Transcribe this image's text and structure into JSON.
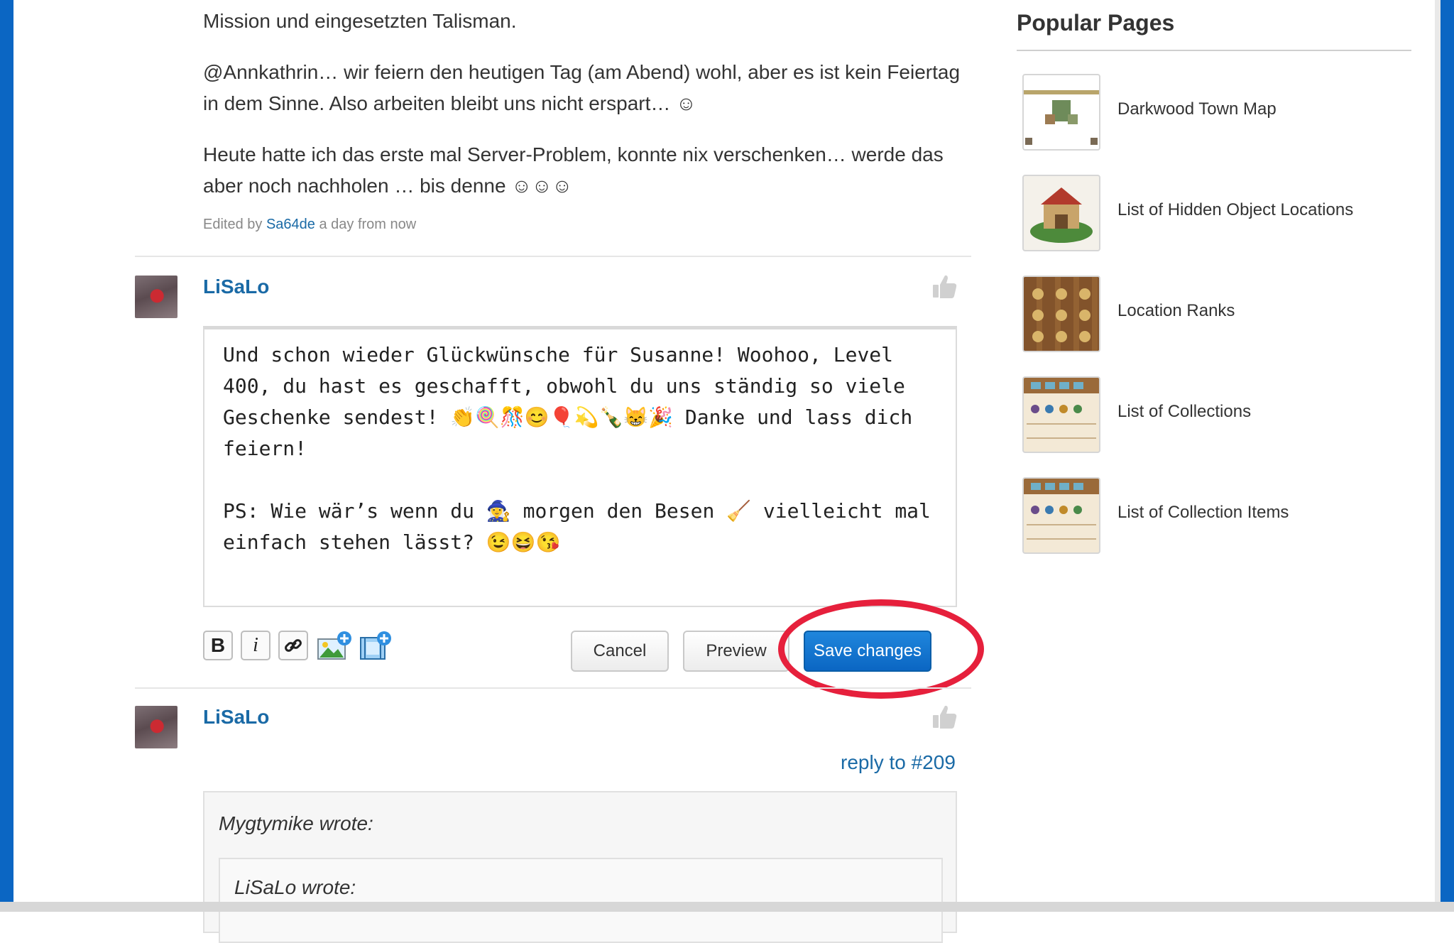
{
  "post_top": {
    "line1": "Mission und eingesetzten Talisman.",
    "para2": "@Annkathrin… wir feiern den heutigen Tag (am Abend) wohl, aber es ist kein Feiertag in dem Sinne. Also arbeiten bleibt uns nicht erspart… ☺",
    "para3": "Heute hatte ich das erste mal Server-Problem, konnte nix verschenken… werde das aber noch nachholen … bis denne ☺☺☺",
    "edited_prefix": "Edited by",
    "edited_user": "Sa64de",
    "edited_time": "a day from now"
  },
  "edit_post": {
    "username": "LiSaLo",
    "text": "Und schon wieder Glückwünsche für Susanne! Woohoo, Level 400, du hast es geschafft, obwohl du uns ständig so viele Geschenke sendest! 👏🍭🎊😊🎈💫🍾😸🎉 Danke und lass dich feiern!\n\nPS: Wie wär’s wenn du 🧙‍♀️ morgen den Besen 🧹 vielleicht mal einfach stehen lässt? 😉😆😘",
    "toolbar": {
      "bold": "B",
      "italic": "i"
    },
    "buttons": {
      "cancel": "Cancel",
      "preview": "Preview",
      "save": "Save changes"
    }
  },
  "next_post": {
    "username": "LiSaLo",
    "reply_link": "reply to #209",
    "quote_author": "Mygtymike wrote:",
    "nested_quote_author": "LiSaLo wrote:"
  },
  "sidebar": {
    "title": "Popular Pages",
    "items": [
      {
        "label": "Darkwood Town Map"
      },
      {
        "label": "List of Hidden Object Locations"
      },
      {
        "label": "Location Ranks"
      },
      {
        "label": "List of Collections"
      },
      {
        "label": "List of Collection Items"
      }
    ]
  },
  "colors": {
    "link": "#1a6aa6",
    "primary_button": "#0b66c3",
    "highlight_ring": "#e6203c",
    "frame": "#0b66c3"
  }
}
